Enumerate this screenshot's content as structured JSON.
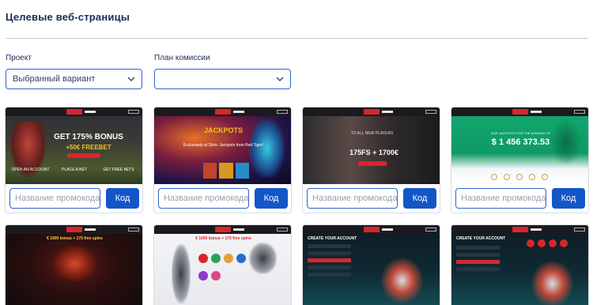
{
  "page": {
    "title": "Целевые веб-страницы"
  },
  "filters": {
    "project_label": "Проект",
    "project_value": "Выбранный вариант",
    "commission_label": "План комиссии",
    "commission_value": ""
  },
  "promo": {
    "placeholder": "Название промокода",
    "button_label": "Код"
  },
  "cards": [
    {
      "headline": "GET 175% BONUS",
      "sub": "+50€ FREEBET",
      "items": [
        "OPEN AN ACCOUNT",
        "PLACE A BET",
        "GET FREE BETS"
      ]
    },
    {
      "headline": "JACKPOTS",
      "sub": "Exclusively at Slotv: Jackpots from Red Tiger!"
    },
    {
      "headline": "175FS + 1700€",
      "sub": "TO ALL NEW PLAYERS"
    },
    {
      "headline": "$ 1 456 373.53",
      "sub": "OUR JACKPOTS FOR THE WINNING OF"
    },
    {
      "headline": "€ 1600 bonus + 175 free spins"
    },
    {
      "headline": "€ 1600 bonus + 175 free spins"
    },
    {
      "headline": "CREATE YOUR ACCOUNT"
    },
    {
      "headline": "CREATE YOUR ACCOUNT"
    }
  ],
  "colors": {
    "accent": "#1356c9",
    "border": "#2f63c9",
    "title": "#1c2a55"
  }
}
